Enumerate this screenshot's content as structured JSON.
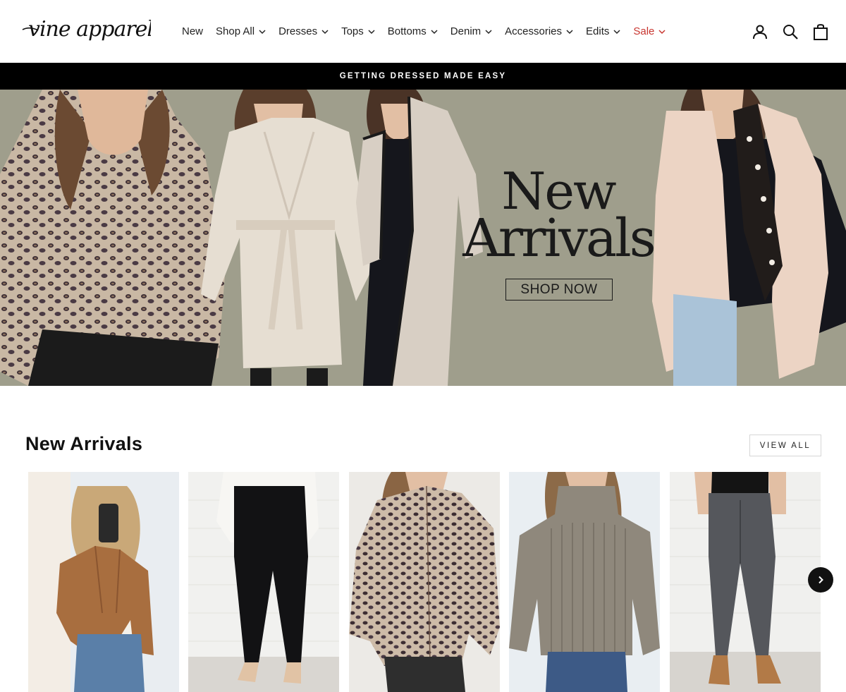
{
  "header": {
    "logo_text": "vine apparel",
    "nav": [
      {
        "label": "New",
        "dropdown": false
      },
      {
        "label": "Shop All",
        "dropdown": true
      },
      {
        "label": "Dresses",
        "dropdown": true
      },
      {
        "label": "Tops",
        "dropdown": true
      },
      {
        "label": "Bottoms",
        "dropdown": true
      },
      {
        "label": "Denim",
        "dropdown": true
      },
      {
        "label": "Accessories",
        "dropdown": true
      },
      {
        "label": "Edits",
        "dropdown": true
      },
      {
        "label": "Sale",
        "dropdown": true,
        "color": "#c8352f"
      }
    ],
    "icons": [
      "account-icon",
      "search-icon",
      "cart-icon"
    ]
  },
  "announcement": {
    "text": "GETTING DRESSED MADE EASY"
  },
  "hero": {
    "title_line1": "New",
    "title_line2": "Arrivals",
    "button_label": "SHOP NOW",
    "background_color": "#9f9e8c"
  },
  "new_arrivals": {
    "title": "New Arrivals",
    "view_all_label": "VIEW ALL",
    "products": [
      {
        "image": "tan-suede-moto-jacket"
      },
      {
        "image": "black-leggings"
      },
      {
        "image": "leopard-print-button-up-top"
      },
      {
        "image": "taupe-knit-sweater"
      },
      {
        "image": "grey-acid-wash-skinny-jeans"
      }
    ]
  },
  "colors": {
    "accent_sale": "#c8352f",
    "announcement_bg": "#000000",
    "hero_bg": "#9f9e8c"
  }
}
